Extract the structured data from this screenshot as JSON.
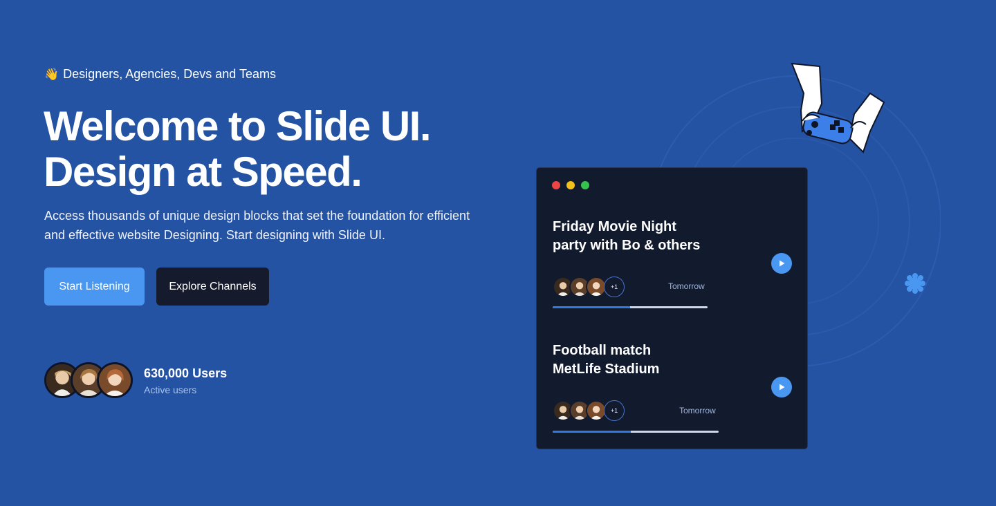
{
  "hero": {
    "eyebrow_icon": "waving-hand-icon",
    "eyebrow_emoji": "👋",
    "eyebrow": "Designers, Agencies, Devs and Teams",
    "headline_line1": "Welcome to Slide UI.",
    "headline_line2": "Design at Speed.",
    "subtitle": "Access thousands of unique design blocks that set the foundation for efficient and effective website Designing. Start designing with Slide UI.",
    "primary_button": "Start Listening",
    "secondary_button": "Explore Channels",
    "users_count": "630,000 Users",
    "users_label": "Active users"
  },
  "card": {
    "events": [
      {
        "title_line1": "Friday Movie Night",
        "title_line2": "party with Bo & others",
        "extra_attendees": "+1",
        "when": "Tomorrow",
        "progress": 0.5
      },
      {
        "title_line1": "Football match",
        "title_line2": "MetLife Stadium",
        "extra_attendees": "+1",
        "when": "Tomorrow",
        "progress": 0.47
      }
    ]
  },
  "colors": {
    "background": "#2553a3",
    "primary": "#4a97f1",
    "dark_button": "#151a2c",
    "card": "#121a2e"
  }
}
